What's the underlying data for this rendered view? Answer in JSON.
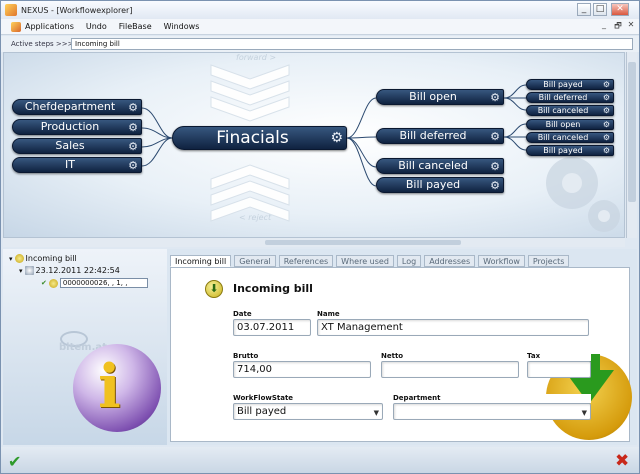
{
  "window": {
    "title": "NEXUS - [Workflowexplorer]",
    "min_label": "_",
    "max_label": "□",
    "close_label": "✕",
    "mdi_min": "_",
    "mdi_restore": "🗗",
    "mdi_close": "✕"
  },
  "menu": {
    "items": [
      "Applications",
      "Undo",
      "FileBase",
      "Windows"
    ]
  },
  "steps": {
    "label": "Active steps >>>",
    "value": "Incoming bill"
  },
  "diagram": {
    "forward_label": "forward >",
    "reject_label": "< reject",
    "gear_glyph": "⚙",
    "sources": [
      "Chefdepartment",
      "Production",
      "Sales",
      "IT"
    ],
    "center": "Finacials",
    "targets": [
      "Bill open",
      "Bill deferred",
      "Bill canceled",
      "Bill payed"
    ],
    "open_children": [
      "Bill payed",
      "Bill deferred",
      "Bill canceled"
    ],
    "deferred_children": [
      "Bill open",
      "Bill canceled",
      "Bill payed"
    ]
  },
  "tree": {
    "root": "Incoming bill",
    "date": "23.12.2011 22:42:54",
    "value": "0000000026, , 1, ,",
    "logo": "bitem.at"
  },
  "tabs": [
    "Incoming bill",
    "General",
    "References",
    "Where used",
    "Log",
    "Addresses",
    "Workflow",
    "Projects"
  ],
  "form": {
    "title": "Incoming bill",
    "date_label": "Date",
    "date_value": "03.07.2011",
    "name_label": "Name",
    "name_value": "XT Management",
    "brutto_label": "Brutto",
    "brutto_value": "714,00",
    "netto_label": "Netto",
    "netto_value": "",
    "tax_label": "Tax",
    "tax_value": "",
    "state_label": "WorkFlowState",
    "state_value": "Bill payed",
    "dept_label": "Department",
    "dept_value": ""
  },
  "icons": {
    "ok": "ok-checkmark-icon",
    "cancel": "cancel-x-icon",
    "gear": "gear-icon"
  }
}
